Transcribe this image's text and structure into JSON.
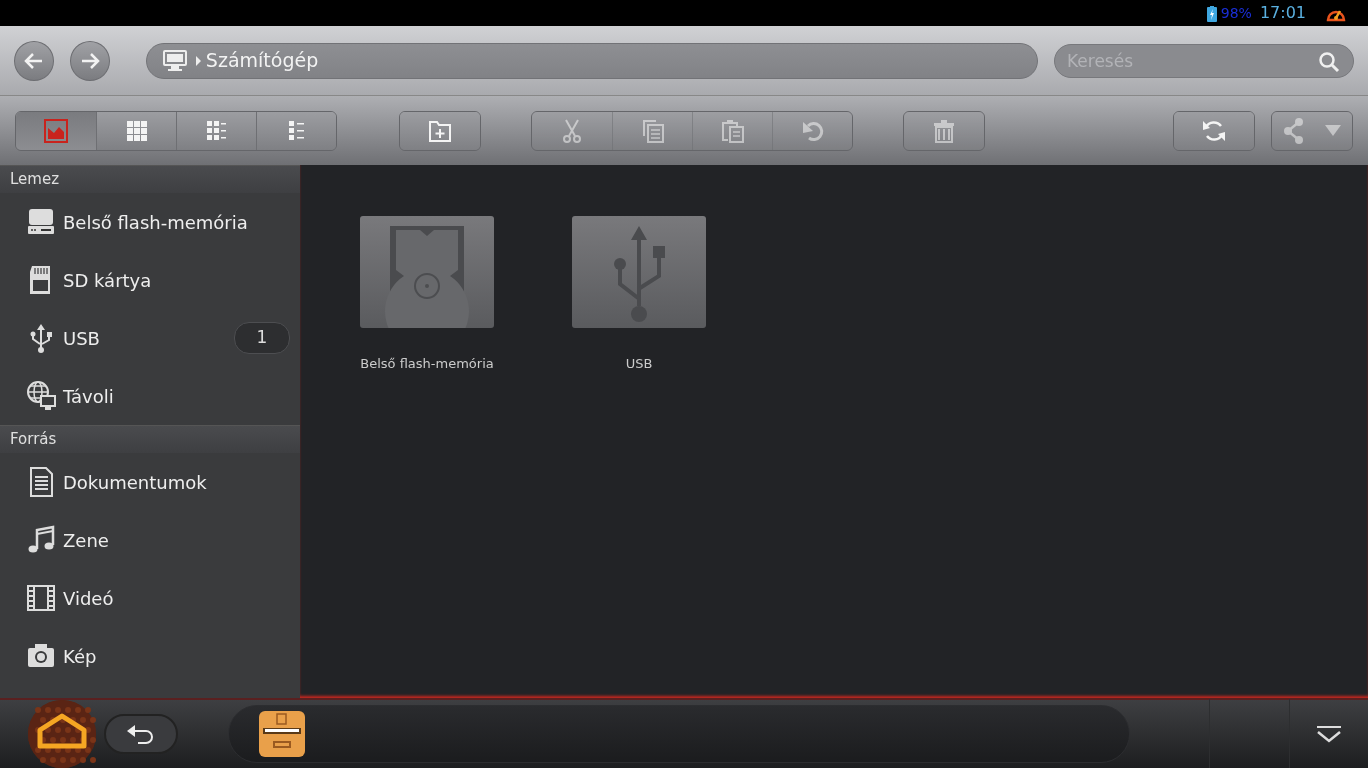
{
  "status_bar": {
    "battery": "98%",
    "time": "17:01"
  },
  "address_bar": {
    "path": "Számítógép"
  },
  "search": {
    "placeholder": "Keresés"
  },
  "toolbar": {
    "view_modes": [
      {
        "kind": "thumbnail",
        "selected": true
      },
      {
        "kind": "grid",
        "selected": false
      },
      {
        "kind": "grid-detail",
        "selected": false
      },
      {
        "kind": "list",
        "selected": false
      }
    ],
    "action_groups": [
      [
        {
          "kind": "new-folder",
          "disabled": false
        }
      ],
      [
        {
          "kind": "cut",
          "disabled": true
        },
        {
          "kind": "copy",
          "disabled": true
        },
        {
          "kind": "paste",
          "disabled": true
        },
        {
          "kind": "undo",
          "disabled": true
        }
      ],
      [
        {
          "kind": "delete",
          "disabled": true
        }
      ],
      [
        {
          "kind": "refresh",
          "disabled": false
        }
      ],
      [
        {
          "kind": "share",
          "disabled": true
        }
      ]
    ]
  },
  "sidebar": [
    {
      "title": "Lemez",
      "items": [
        {
          "kind": "drive",
          "label": "Belső flash-memória"
        },
        {
          "kind": "sd",
          "label": "SD kártya"
        },
        {
          "kind": "usb",
          "label": "USB",
          "badge": "1"
        },
        {
          "kind": "remote",
          "label": "Távoli"
        }
      ]
    },
    {
      "title": "Forrás",
      "items": [
        {
          "kind": "document",
          "label": "Dokumentumok"
        },
        {
          "kind": "music",
          "label": "Zene"
        },
        {
          "kind": "video",
          "label": "Videó"
        },
        {
          "kind": "photo",
          "label": "Kép"
        }
      ]
    }
  ],
  "tiles": [
    {
      "kind": "drive",
      "label": "Belső flash-memória"
    },
    {
      "kind": "usb",
      "label": "USB"
    }
  ]
}
